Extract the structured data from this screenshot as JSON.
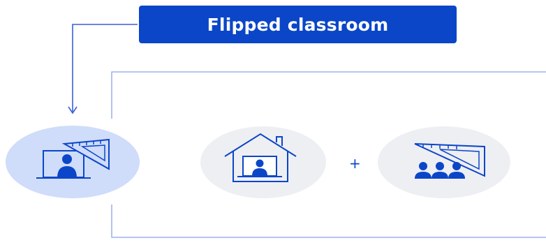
{
  "header": {
    "title": "Flipped classroom"
  },
  "diagram": {
    "operator": "+",
    "nodes": [
      {
        "icon": "teacher-screen-ruler-icon",
        "state": "highlighted"
      },
      {
        "icon": "home-laptop-learner-icon",
        "state": "normal"
      },
      {
        "icon": "classroom-group-ruler-icon",
        "state": "normal"
      }
    ]
  },
  "colors": {
    "accent": "#0b46c8",
    "highlight_circle": "#cfdcfa",
    "muted_circle": "#eeeff3",
    "line": "#3b5fd6",
    "bracket": "#8aa2e6"
  }
}
